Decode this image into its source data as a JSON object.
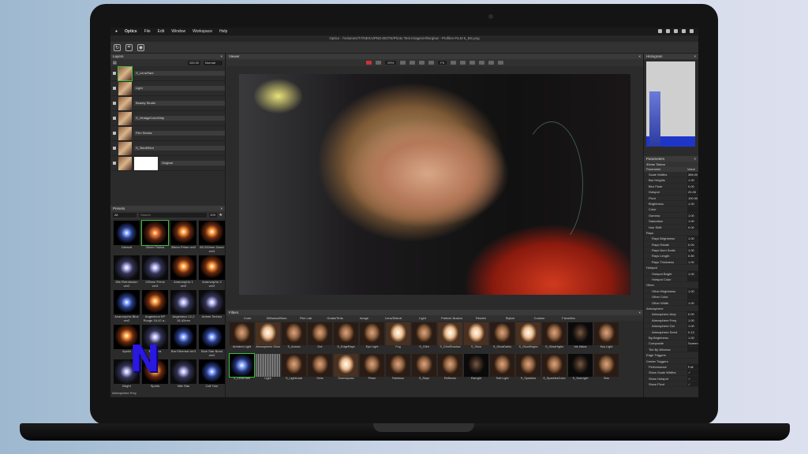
{
  "menubar": {
    "app": "Optics",
    "items": [
      "File",
      "Edit",
      "Window",
      "Workspace",
      "Help"
    ]
  },
  "window_title": "Optics - /Volumes/T7/NEXA/PNG-BOTS/Photo Test Images/Afterglow - Profiles-FILM 5_BS.png",
  "layers": {
    "title": "Layers",
    "opacity": "100.00",
    "blend_mode": "Normal",
    "rows": [
      "S_LensFlare",
      "Light",
      "Beauty Studio",
      "S_VintageColorStrip",
      "Film Stocks",
      "S_SkinEffect",
      "Original"
    ]
  },
  "presets": {
    "title": "Presets",
    "filter": "All",
    "search_placeholder": "Search",
    "count": "109",
    "items": [
      "Default",
      "30mm Tokina",
      "35mm Prime ver2",
      "85-200mm Zoom ver3",
      "80s Retrofusion ver2",
      "135mm Prime ver3",
      "Anamorphic 1 ver2",
      "Anamorphic 2 ver2",
      "Anamorphic Blue ver2",
      "Angenieux EP Rouge 16-42 a...",
      "Angenieux 12-2 15-42mm",
      "Anime Techno",
      "Apollo",
      "Bambina",
      "Bar Ethereal ver3",
      "Blue Star Burst ver2",
      "Bright",
      "Sports",
      "Nite Star",
      "Call Your"
    ],
    "footer": "Atmosphere Prey"
  },
  "viewer": {
    "title": "Viewer",
    "zoom": "90%",
    "fit": "Fit"
  },
  "filters": {
    "title": "Filters",
    "categories": [
      "Color",
      "Diffusion/Blurs",
      "Film Lab",
      "Grads/Tints",
      "Image",
      "Lens/Distort",
      "Light",
      "Particle Illusion",
      "Render",
      "Stylize",
      "Custom",
      "Favorites"
    ],
    "row1": [
      "Ambient Light",
      "Atmospheric Glow",
      "S_Aurora",
      "Dot",
      "S_EdgeRays",
      "Eye Light",
      "Fog",
      "S_Glint",
      "S_GlintShadow",
      "S_Glow",
      "S_GlowDarks",
      "S_GlowEdges",
      "S_GlowHighs",
      "Iris Halos",
      "Key Light"
    ],
    "row2": [
      "S_LensFlare",
      "Light",
      "S_LightLeak",
      "Orbe",
      "Overexpose",
      "Prism",
      "Rainbow",
      "S_Rays",
      "Reflector",
      "RaLight",
      "Soft Light",
      "S_Sparkles",
      "S_SparklesColor",
      "S_SunLight",
      "Star"
    ]
  },
  "histogram": {
    "title": "Histogram"
  },
  "parameters": {
    "title": "Parameters",
    "preset": "30mm Tokina",
    "col_param": "Parameter",
    "col_value": "Value",
    "rows": [
      {
        "name": "Scale Widths",
        "value": "366.00",
        "kind": "item"
      },
      {
        "name": "Bar Heights",
        "value": "1.00",
        "kind": "item"
      },
      {
        "name": "Blur Flare",
        "value": "0.00",
        "kind": "item"
      },
      {
        "name": "Hotspot",
        "value": "20.26",
        "kind": "item"
      },
      {
        "name": "Pivot",
        "value": "100.00",
        "kind": "item"
      },
      {
        "name": "Brightness",
        "value": "1.00",
        "kind": "item"
      },
      {
        "name": "Color",
        "value": "",
        "kind": "item"
      },
      {
        "name": "Gamma",
        "value": "1.00",
        "kind": "item"
      },
      {
        "name": "Saturation",
        "value": "1.00",
        "kind": "item"
      },
      {
        "name": "Hue Shift",
        "value": "0.00",
        "kind": "item"
      },
      {
        "name": "Rays",
        "value": "",
        "kind": "group"
      },
      {
        "name": "Rays Brightness",
        "value": "1.00",
        "kind": "sub"
      },
      {
        "name": "Rays Rotate",
        "value": "0.00",
        "kind": "sub"
      },
      {
        "name": "Rays Num Scale",
        "value": "1.00",
        "kind": "sub"
      },
      {
        "name": "Rays Length",
        "value": "0.80",
        "kind": "sub"
      },
      {
        "name": "Rays Thickness",
        "value": "1.00",
        "kind": "sub"
      },
      {
        "name": "Hotspot",
        "value": "",
        "kind": "group"
      },
      {
        "name": "Hotspot Bright",
        "value": "1.00",
        "kind": "sub"
      },
      {
        "name": "Hotspot Color",
        "value": "",
        "kind": "sub"
      },
      {
        "name": "Other",
        "value": "",
        "kind": "group"
      },
      {
        "name": "Other Brightness",
        "value": "1.00",
        "kind": "sub"
      },
      {
        "name": "Other Color",
        "value": "",
        "kind": "sub"
      },
      {
        "name": "Other Width",
        "value": "1.00",
        "kind": "sub"
      },
      {
        "name": "Atmosphere",
        "value": "",
        "kind": "group"
      },
      {
        "name": "Atmosphere Amp",
        "value": "0.00",
        "kind": "sub"
      },
      {
        "name": "Atmosphere Freq",
        "value": "1.00",
        "kind": "sub"
      },
      {
        "name": "Atmosphere Oct",
        "value": "1.00",
        "kind": "sub"
      },
      {
        "name": "Atmosphere Seed",
        "value": "0.13",
        "kind": "sub"
      },
      {
        "name": "Bg Brightness",
        "value": "1.00",
        "kind": "item"
      },
      {
        "name": "Composite",
        "value": "Screen",
        "kind": "item"
      },
      {
        "name": "Tint By Window",
        "value": "",
        "kind": "item"
      },
      {
        "name": "Edge Triggers",
        "value": "",
        "kind": "group"
      },
      {
        "name": "Center Triggers",
        "value": "",
        "kind": "group"
      },
      {
        "name": "Performance",
        "value": "Full Res",
        "kind": "item"
      },
      {
        "name": "Show Scale Widths",
        "value": "✓",
        "kind": "item"
      },
      {
        "name": "Show Hotspot",
        "value": "✓",
        "kind": "item"
      },
      {
        "name": "Show Pivot",
        "value": "✓",
        "kind": "item"
      }
    ]
  },
  "logo": "N",
  "colors": {
    "selection": "#3dbf3d",
    "logo": "#2a18e0"
  }
}
